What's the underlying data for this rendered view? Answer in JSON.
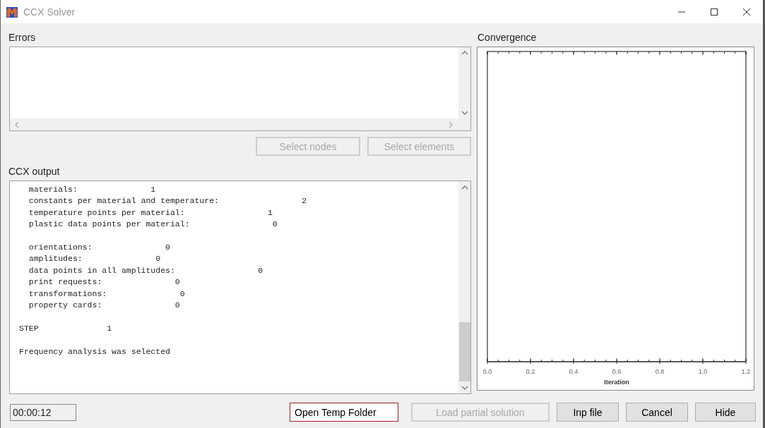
{
  "window": {
    "title": "CCX Solver"
  },
  "errors": {
    "label": "Errors"
  },
  "error_buttons": [
    {
      "label": "Select nodes",
      "disabled": true
    },
    {
      "label": "Select elements",
      "disabled": true
    }
  ],
  "output": {
    "label": "CCX output",
    "blocks": [
      {
        "kind": "detail",
        "lines": [
          "  materials:               1",
          "  constants per material and temperature:                 2",
          "  temperature points per material:                 1",
          "  plastic data points per material:                 0"
        ]
      },
      {
        "kind": "detail",
        "lines": [
          "  orientations:               0",
          "  amplitudes:               0",
          "  data points in all amplitudes:                 0",
          "  print requests:               0",
          "  transformations:               0",
          "  property cards:               0"
        ]
      },
      {
        "kind": "section",
        "lines": [
          "STEP              1"
        ]
      },
      {
        "kind": "detail",
        "lines": [
          "Frequency analysis was selected"
        ]
      }
    ]
  },
  "convergence": {
    "label": "Convergence",
    "plot": {
      "axis_title": "Iteration",
      "tick_labels": [
        "0.0",
        "0.2",
        "0.4",
        "0.6",
        "0.8",
        "1.0",
        "1.2"
      ]
    }
  },
  "footer": {
    "elapsed": "00:00:12",
    "buttons": [
      {
        "label": "Open Temp Folder",
        "disabled": false,
        "focused": true
      },
      {
        "label": "Load partial solution",
        "disabled": true,
        "focused": false
      },
      {
        "label": "Inp file",
        "disabled": false,
        "focused": false
      },
      {
        "label": "Cancel",
        "disabled": false,
        "focused": false
      },
      {
        "label": "Hide",
        "disabled": false,
        "focused": false
      }
    ]
  }
}
